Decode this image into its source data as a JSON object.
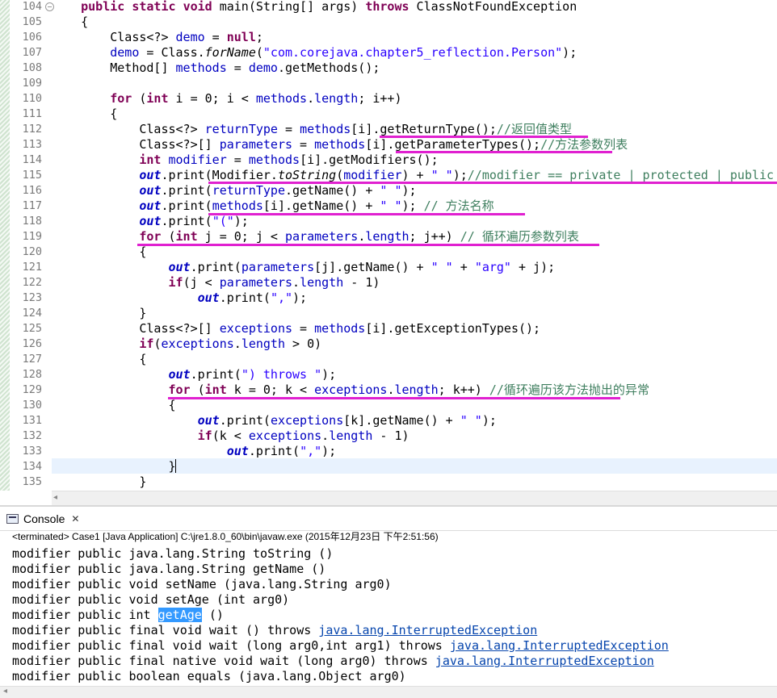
{
  "editor": {
    "lines": [
      {
        "no": "104",
        "parts": [
          [
            "t",
            "    "
          ],
          [
            "kw",
            "public"
          ],
          [
            "t",
            " "
          ],
          [
            "kw",
            "static"
          ],
          [
            "t",
            " "
          ],
          [
            "kw",
            "void"
          ],
          [
            "t",
            " main(String[] args) "
          ],
          [
            "kw",
            "throws"
          ],
          [
            "t",
            " ClassNotFoundException"
          ]
        ]
      },
      {
        "no": "105",
        "parts": [
          [
            "t",
            "    {"
          ]
        ]
      },
      {
        "no": "106",
        "parts": [
          [
            "t",
            "        Class<?> "
          ],
          [
            "fld",
            "demo"
          ],
          [
            "t",
            " = "
          ],
          [
            "kw",
            "null"
          ],
          [
            "t",
            ";"
          ]
        ]
      },
      {
        "no": "107",
        "parts": [
          [
            "t",
            "        "
          ],
          [
            "fld",
            "demo"
          ],
          [
            "t",
            " = Class."
          ],
          [
            "sti",
            "forName"
          ],
          [
            "t",
            "("
          ],
          [
            "str",
            "\"com.corejava.chapter5_reflection.Person\""
          ],
          [
            "t",
            ");"
          ]
        ]
      },
      {
        "no": "108",
        "parts": [
          [
            "t",
            "        Method[] "
          ],
          [
            "fld",
            "methods"
          ],
          [
            "t",
            " = "
          ],
          [
            "fld",
            "demo"
          ],
          [
            "t",
            ".getMethods();"
          ]
        ]
      },
      {
        "no": "109",
        "parts": []
      },
      {
        "no": "110",
        "parts": [
          [
            "t",
            "        "
          ],
          [
            "kw",
            "for"
          ],
          [
            "t",
            " ("
          ],
          [
            "kw",
            "int"
          ],
          [
            "t",
            " i = 0; i < "
          ],
          [
            "fld",
            "methods"
          ],
          [
            "t",
            "."
          ],
          [
            "fld",
            "length"
          ],
          [
            "t",
            "; i++)"
          ]
        ]
      },
      {
        "no": "111",
        "parts": [
          [
            "t",
            "        {"
          ]
        ]
      },
      {
        "no": "112",
        "parts": [
          [
            "t",
            "            Class<?> "
          ],
          [
            "fld",
            "returnType"
          ],
          [
            "t",
            " = "
          ],
          [
            "fld",
            "methods"
          ],
          [
            "t",
            "[i].getReturnType();"
          ],
          [
            "cm",
            "//返回值类型"
          ]
        ]
      },
      {
        "no": "113",
        "parts": [
          [
            "t",
            "            Class<?>[] "
          ],
          [
            "fld",
            "parameters"
          ],
          [
            "t",
            " = "
          ],
          [
            "fld",
            "methods"
          ],
          [
            "t",
            "[i].getParameterTypes();"
          ],
          [
            "cm",
            "//方法参数列表"
          ]
        ]
      },
      {
        "no": "114",
        "parts": [
          [
            "t",
            "            "
          ],
          [
            "kw",
            "int"
          ],
          [
            "t",
            " "
          ],
          [
            "fld",
            "modifier"
          ],
          [
            "t",
            " = "
          ],
          [
            "fld",
            "methods"
          ],
          [
            "t",
            "[i].getModifiers();"
          ]
        ]
      },
      {
        "no": "115",
        "parts": [
          [
            "t",
            "            "
          ],
          [
            "st",
            "out"
          ],
          [
            "t",
            ".print(Modifier."
          ],
          [
            "sti",
            "toString"
          ],
          [
            "t",
            "("
          ],
          [
            "fld",
            "modifier"
          ],
          [
            "t",
            ") + "
          ],
          [
            "str",
            "\" \""
          ],
          [
            "t",
            ");"
          ],
          [
            "cm",
            "//modifier == private | protected | public"
          ]
        ]
      },
      {
        "no": "116",
        "parts": [
          [
            "t",
            "            "
          ],
          [
            "st",
            "out"
          ],
          [
            "t",
            ".print("
          ],
          [
            "fld",
            "returnType"
          ],
          [
            "t",
            ".getName() + "
          ],
          [
            "str",
            "\" \""
          ],
          [
            "t",
            ");"
          ]
        ]
      },
      {
        "no": "117",
        "parts": [
          [
            "t",
            "            "
          ],
          [
            "st",
            "out"
          ],
          [
            "t",
            ".print("
          ],
          [
            "fld",
            "methods"
          ],
          [
            "t",
            "[i].getName() + "
          ],
          [
            "str",
            "\" \""
          ],
          [
            "t",
            "); "
          ],
          [
            "cm",
            "// 方法名称"
          ]
        ]
      },
      {
        "no": "118",
        "parts": [
          [
            "t",
            "            "
          ],
          [
            "st",
            "out"
          ],
          [
            "t",
            ".print("
          ],
          [
            "str",
            "\"(\""
          ],
          [
            "t",
            ");"
          ]
        ]
      },
      {
        "no": "119",
        "parts": [
          [
            "t",
            "            "
          ],
          [
            "kw",
            "for"
          ],
          [
            "t",
            " ("
          ],
          [
            "kw",
            "int"
          ],
          [
            "t",
            " j = 0; j < "
          ],
          [
            "fld",
            "parameters"
          ],
          [
            "t",
            "."
          ],
          [
            "fld",
            "length"
          ],
          [
            "t",
            "; j++) "
          ],
          [
            "cm",
            "// 循环遍历参数列表"
          ]
        ]
      },
      {
        "no": "120",
        "parts": [
          [
            "t",
            "            {"
          ]
        ]
      },
      {
        "no": "121",
        "parts": [
          [
            "t",
            "                "
          ],
          [
            "st",
            "out"
          ],
          [
            "t",
            ".print("
          ],
          [
            "fld",
            "parameters"
          ],
          [
            "t",
            "[j].getName() + "
          ],
          [
            "str",
            "\" \""
          ],
          [
            "t",
            " + "
          ],
          [
            "str",
            "\"arg\""
          ],
          [
            "t",
            " + j);"
          ]
        ]
      },
      {
        "no": "122",
        "parts": [
          [
            "t",
            "                "
          ],
          [
            "kw",
            "if"
          ],
          [
            "t",
            "(j < "
          ],
          [
            "fld",
            "parameters"
          ],
          [
            "t",
            "."
          ],
          [
            "fld",
            "length"
          ],
          [
            "t",
            " - 1)"
          ]
        ]
      },
      {
        "no": "123",
        "parts": [
          [
            "t",
            "                    "
          ],
          [
            "st",
            "out"
          ],
          [
            "t",
            ".print("
          ],
          [
            "str",
            "\",\""
          ],
          [
            "t",
            ");"
          ]
        ]
      },
      {
        "no": "124",
        "parts": [
          [
            "t",
            "            }"
          ]
        ]
      },
      {
        "no": "125",
        "parts": [
          [
            "t",
            "            Class<?>[] "
          ],
          [
            "fld",
            "exceptions"
          ],
          [
            "t",
            " = "
          ],
          [
            "fld",
            "methods"
          ],
          [
            "t",
            "[i].getExceptionTypes();"
          ]
        ]
      },
      {
        "no": "126",
        "parts": [
          [
            "t",
            "            "
          ],
          [
            "kw",
            "if"
          ],
          [
            "t",
            "("
          ],
          [
            "fld",
            "exceptions"
          ],
          [
            "t",
            "."
          ],
          [
            "fld",
            "length"
          ],
          [
            "t",
            " > 0)"
          ]
        ]
      },
      {
        "no": "127",
        "parts": [
          [
            "t",
            "            {"
          ]
        ]
      },
      {
        "no": "128",
        "parts": [
          [
            "t",
            "                "
          ],
          [
            "st",
            "out"
          ],
          [
            "t",
            ".print("
          ],
          [
            "str",
            "\") throws \""
          ],
          [
            "t",
            ");"
          ]
        ]
      },
      {
        "no": "129",
        "parts": [
          [
            "t",
            "                "
          ],
          [
            "kw",
            "for"
          ],
          [
            "t",
            " ("
          ],
          [
            "kw",
            "int"
          ],
          [
            "t",
            " k = 0; k < "
          ],
          [
            "fld",
            "exceptions"
          ],
          [
            "t",
            "."
          ],
          [
            "fld",
            "length"
          ],
          [
            "t",
            "; k++) "
          ],
          [
            "cm",
            "//循环遍历该方法抛出的异常"
          ]
        ]
      },
      {
        "no": "130",
        "parts": [
          [
            "t",
            "                {"
          ]
        ]
      },
      {
        "no": "131",
        "parts": [
          [
            "t",
            "                    "
          ],
          [
            "st",
            "out"
          ],
          [
            "t",
            ".print("
          ],
          [
            "fld",
            "exceptions"
          ],
          [
            "t",
            "[k].getName() + "
          ],
          [
            "str",
            "\" \""
          ],
          [
            "t",
            ");"
          ]
        ]
      },
      {
        "no": "132",
        "parts": [
          [
            "t",
            "                    "
          ],
          [
            "kw",
            "if"
          ],
          [
            "t",
            "(k < "
          ],
          [
            "fld",
            "exceptions"
          ],
          [
            "t",
            "."
          ],
          [
            "fld",
            "length"
          ],
          [
            "t",
            " - 1)"
          ]
        ]
      },
      {
        "no": "133",
        "parts": [
          [
            "t",
            "                        "
          ],
          [
            "st",
            "out"
          ],
          [
            "t",
            ".print("
          ],
          [
            "str",
            "\",\""
          ],
          [
            "t",
            ");"
          ]
        ]
      },
      {
        "no": "134",
        "parts": [
          [
            "t",
            "                }"
          ]
        ]
      },
      {
        "no": "135",
        "parts": [
          [
            "t",
            "            }"
          ]
        ]
      }
    ]
  },
  "console": {
    "tab_label": "Console",
    "tab_icon": "console-icon",
    "close_symbol": "✕",
    "status": "<terminated> Case1 [Java Application] C:\\jre1.8.0_60\\bin\\javaw.exe (2015年12月23日 下午2:51:56)",
    "output": [
      {
        "parts": [
          [
            "t",
            "modifier public java.lang.String toString ()"
          ]
        ]
      },
      {
        "parts": [
          [
            "t",
            "modifier public java.lang.String getName ()"
          ]
        ]
      },
      {
        "parts": [
          [
            "t",
            "modifier public void setName (java.lang.String arg0)"
          ]
        ]
      },
      {
        "parts": [
          [
            "t",
            "modifier public void setAge (int arg0)"
          ]
        ]
      },
      {
        "parts": [
          [
            "t",
            "modifier public int "
          ],
          [
            "sel",
            "getAge"
          ],
          [
            "t",
            " ()"
          ]
        ]
      },
      {
        "parts": [
          [
            "t",
            "modifier public final void wait () throws "
          ],
          [
            "link",
            "java.lang.InterruptedException"
          ]
        ]
      },
      {
        "parts": [
          [
            "t",
            "modifier public final void wait (long arg0,int arg1) throws "
          ],
          [
            "link",
            "java.lang.InterruptedException"
          ]
        ]
      },
      {
        "parts": [
          [
            "t",
            "modifier public final native void wait (long arg0) throws "
          ],
          [
            "link",
            "java.lang.InterruptedException"
          ]
        ]
      },
      {
        "parts": [
          [
            "t",
            "modifier public boolean equals (java.lang.Object arg0)"
          ]
        ]
      }
    ]
  },
  "colors": {
    "keyword": "#7f0055",
    "field": "#0000c0",
    "string": "#2a00ff",
    "comment": "#3f7f5f",
    "annotation_underline": "#e020d0",
    "selection": "#3399ff",
    "link": "#0645ad"
  }
}
